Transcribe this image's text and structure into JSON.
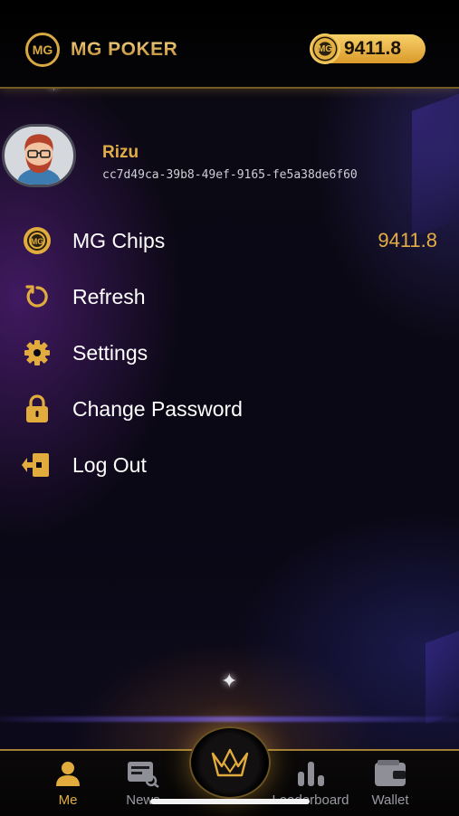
{
  "header": {
    "brand": "MG POKER",
    "logo_mark": "MG",
    "balance": "9411.8"
  },
  "profile": {
    "name": "Rizu",
    "id": "cc7d49ca-39b8-49ef-9165-fe5a38de6f60"
  },
  "menu": [
    {
      "label": "MG Chips",
      "value": "9411.8",
      "icon": "chip-icon"
    },
    {
      "label": "Refresh",
      "icon": "refresh-icon"
    },
    {
      "label": "Settings",
      "icon": "gear-icon"
    },
    {
      "label": "Change Password",
      "icon": "lock-icon"
    },
    {
      "label": "Log Out",
      "icon": "logout-icon"
    }
  ],
  "nav": {
    "me": "Me",
    "news": "News",
    "leaderboard": "Leaderboard",
    "wallet": "Wallet"
  },
  "colors": {
    "accent": "#e3ad46",
    "background": "#07060d"
  }
}
